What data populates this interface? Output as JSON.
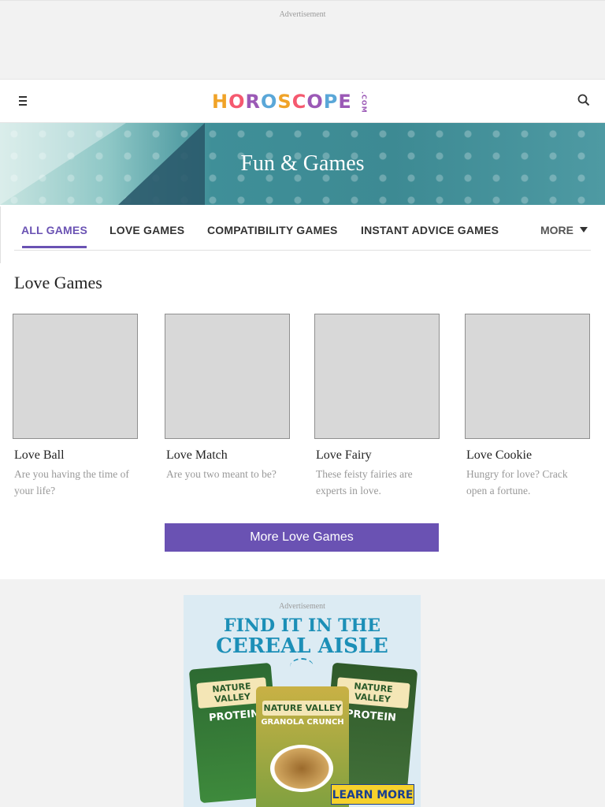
{
  "ads": {
    "top_label": "Advertisement",
    "bottom_label": "Advertisement",
    "bottom_headline_1": "FIND IT IN THE",
    "bottom_headline_2": "CEREAL AISLE",
    "left_pkg_brand": "NATURE VALLEY",
    "left_pkg_product": "PROTEIN",
    "mid_pkg_brand": "NATURE VALLEY",
    "mid_pkg_product": "GRANOLA CRUNCH",
    "right_pkg_brand": "NATURE VALLEY",
    "right_pkg_product": "PROTEIN",
    "cta": "LEARN MORE"
  },
  "header": {
    "logo_parts": [
      "H",
      "O",
      "R",
      "O",
      "S",
      "C",
      "O",
      "P",
      "E"
    ],
    "logo_suffix": ".COM"
  },
  "hero": {
    "title": "Fun & Games"
  },
  "tabs": {
    "items": [
      "ALL GAMES",
      "LOVE GAMES",
      "COMPATIBILITY GAMES",
      "INSTANT ADVICE GAMES"
    ],
    "more": "MORE"
  },
  "section": {
    "title": "Love Games",
    "cards": [
      {
        "title": "Love Ball",
        "desc": "Are you having the time of your life?"
      },
      {
        "title": "Love Match",
        "desc": "Are you two meant to be?"
      },
      {
        "title": "Love Fairy",
        "desc": "These feisty fairies are experts in love."
      },
      {
        "title": "Love Cookie",
        "desc": "Hungry for love? Crack open a fortune."
      }
    ],
    "more_button": "More Love Games"
  },
  "colors": {
    "accent": "#6a52b3",
    "hero_teal": "#3f8f98"
  }
}
